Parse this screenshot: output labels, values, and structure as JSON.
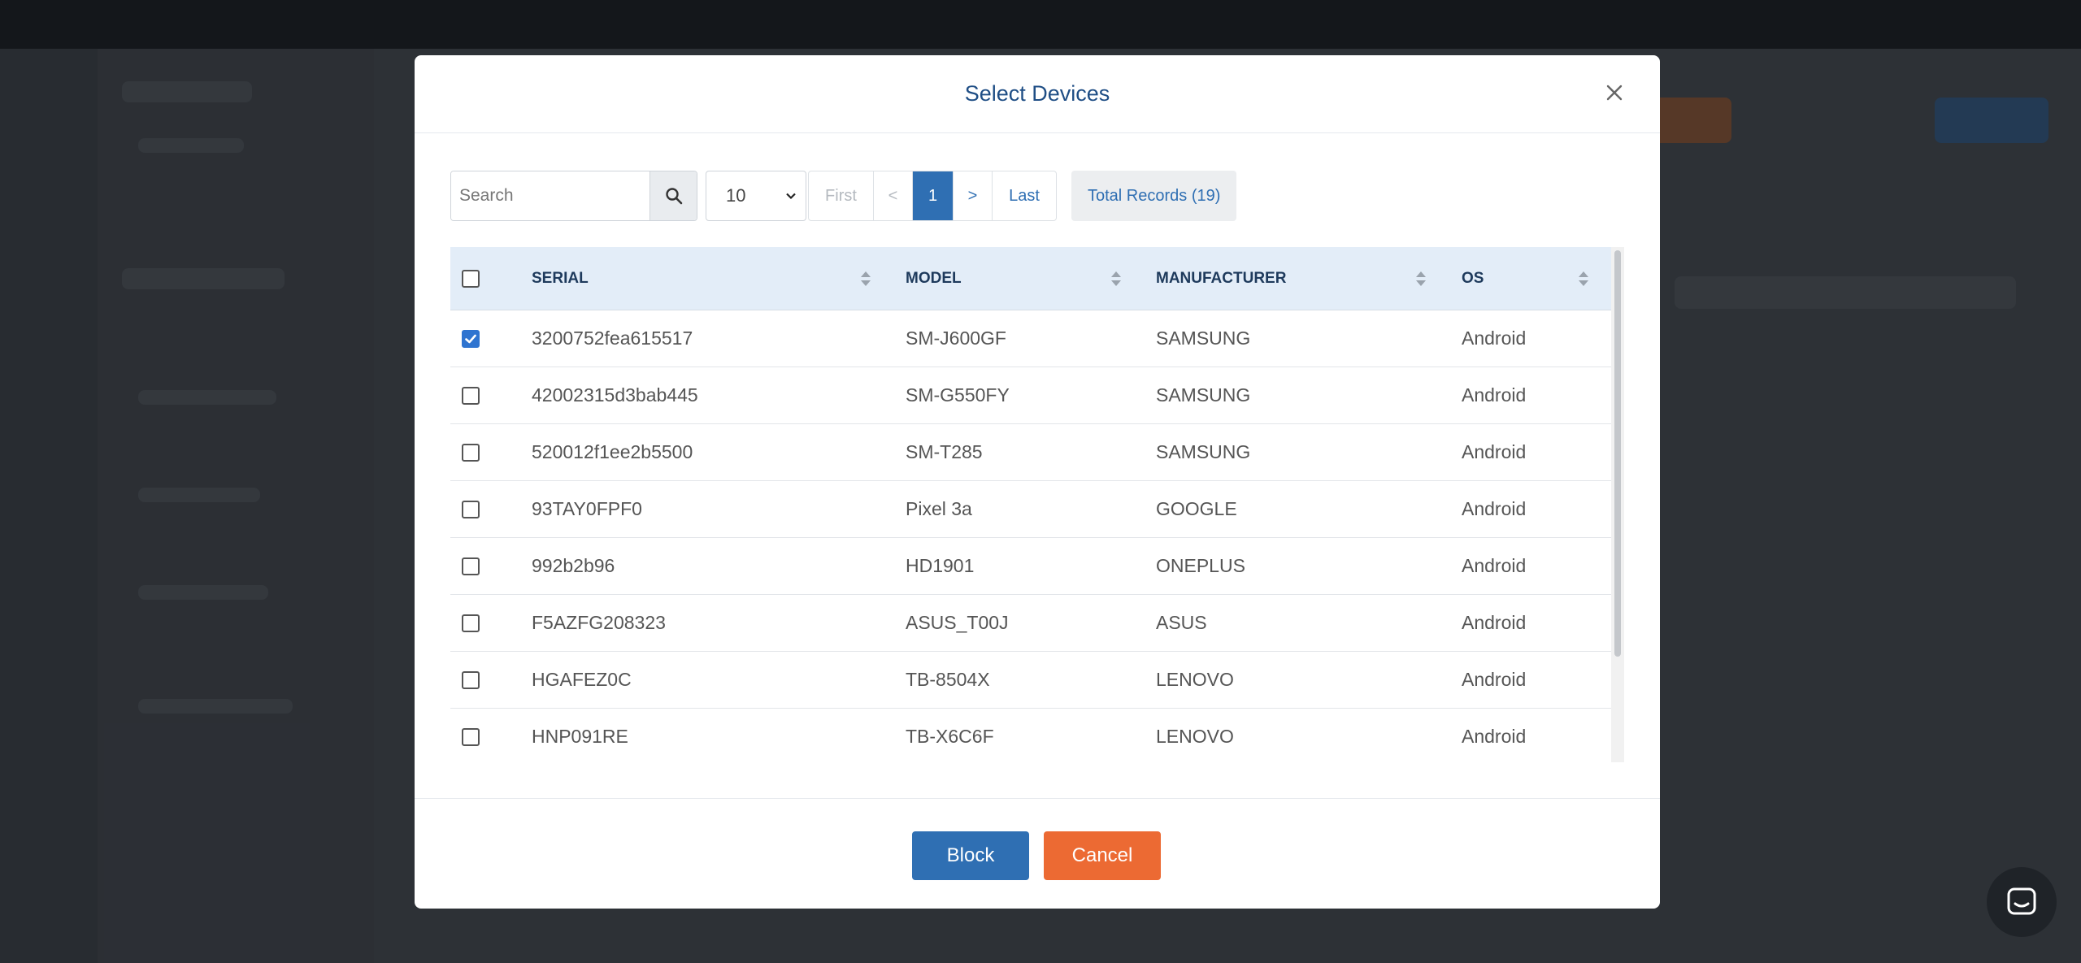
{
  "modal": {
    "title": "Select Devices",
    "close_icon": "close-icon"
  },
  "toolbar": {
    "search_placeholder": "Search",
    "page_size": "10",
    "pager": {
      "first": "First",
      "prev": "<",
      "current": "1",
      "next": ">",
      "last": "Last"
    },
    "total_label": "Total Records",
    "total_count": "(19)"
  },
  "table": {
    "columns": [
      {
        "label": "SERIAL"
      },
      {
        "label": "MODEL"
      },
      {
        "label": "MANUFACTURER"
      },
      {
        "label": "OS"
      }
    ],
    "rows": [
      {
        "checked": true,
        "serial": "3200752fea615517",
        "model": "SM-J600GF",
        "manufacturer": "SAMSUNG",
        "os": "Android"
      },
      {
        "checked": false,
        "serial": "42002315d3bab445",
        "model": "SM-G550FY",
        "manufacturer": "SAMSUNG",
        "os": "Android"
      },
      {
        "checked": false,
        "serial": "520012f1ee2b5500",
        "model": "SM-T285",
        "manufacturer": "SAMSUNG",
        "os": "Android"
      },
      {
        "checked": false,
        "serial": "93TAY0FPF0",
        "model": "Pixel 3a",
        "manufacturer": "GOOGLE",
        "os": "Android"
      },
      {
        "checked": false,
        "serial": "992b2b96",
        "model": "HD1901",
        "manufacturer": "ONEPLUS",
        "os": "Android"
      },
      {
        "checked": false,
        "serial": "F5AZFG208323",
        "model": "ASUS_T00J",
        "manufacturer": "ASUS",
        "os": "Android"
      },
      {
        "checked": false,
        "serial": "HGAFEZ0C",
        "model": "TB-8504X",
        "manufacturer": "LENOVO",
        "os": "Android"
      },
      {
        "checked": false,
        "serial": "HNP091RE",
        "model": "TB-X6C6F",
        "manufacturer": "LENOVO",
        "os": "Android"
      }
    ]
  },
  "footer": {
    "block_label": "Block",
    "cancel_label": "Cancel"
  },
  "colors": {
    "primary": "#2f6fb3",
    "cancel": "#ec6a33",
    "title": "#1f4e85",
    "header_bg": "#e3edf8"
  }
}
